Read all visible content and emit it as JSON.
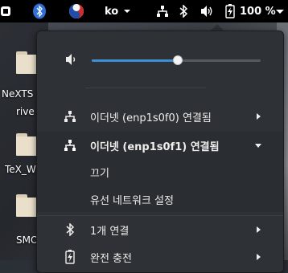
{
  "topbar": {
    "input_method": "ko",
    "battery_percent": "100 %",
    "icons": [
      "bluetooth-app-icon",
      "keyboard-input-icon",
      "network-wired-icon",
      "bluetooth-icon",
      "volume-icon",
      "battery-charging-icon",
      "power-menu-icon"
    ]
  },
  "desktop": {
    "items": [
      {
        "label": "NeXTS"
      },
      {
        "label": "rive"
      },
      {
        "label": "TeX_W"
      },
      {
        "label": "SMO"
      }
    ]
  },
  "menu": {
    "volume": {
      "level_percent": 51,
      "icon": "volume-low-icon"
    },
    "network_rows": [
      {
        "label": "이더넷 (enp1s0f0) 연결됨",
        "icon": "network-wired-icon",
        "expanded": false
      },
      {
        "label": "이더넷 (enp1s0f1) 연결됨",
        "icon": "network-wired-icon",
        "expanded": true
      }
    ],
    "submenu": [
      {
        "label": "끄기"
      },
      {
        "label": "유선 네트워크 설정"
      }
    ],
    "bluetooth": {
      "label": "1개 연결",
      "icon": "bluetooth-icon"
    },
    "power": {
      "label": "완전 충전",
      "icon": "battery-icon"
    }
  },
  "colors": {
    "accent": "#3d8fd8",
    "menu_bg": "#2e3135",
    "topbar_bg": "#000000"
  }
}
